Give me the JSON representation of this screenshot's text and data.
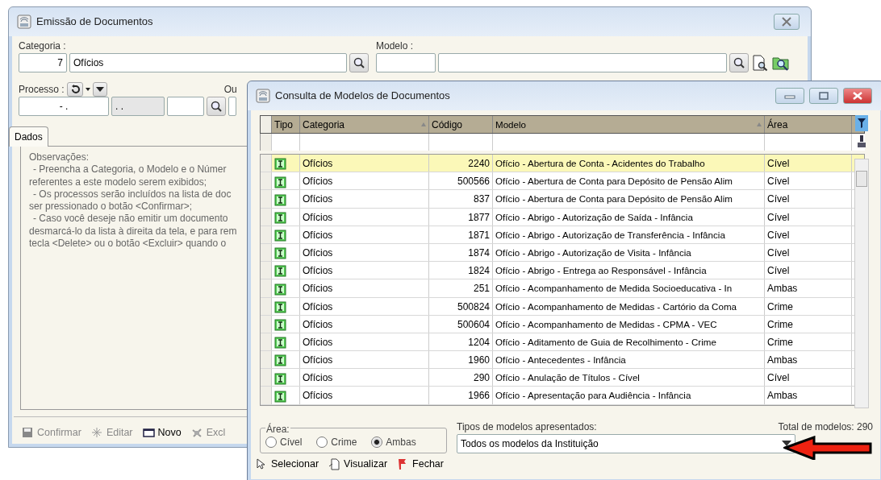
{
  "main_window": {
    "title": "Emissão de Documentos",
    "categoria": {
      "label": "Categoria :",
      "code": "7",
      "name": "Ofícios"
    },
    "modelo": {
      "label": "Modelo :"
    },
    "processo": {
      "label": "Processo :",
      "field_1": "- .",
      "field_2": ". ."
    },
    "cut_label": "Ou",
    "tabs": [
      {
        "label": "Dados",
        "selected": true
      }
    ],
    "notes": [
      "Observações:",
      "- Preencha a Categoria, o Modelo e o Númer",
      "referentes a este modelo serem exibidos;",
      "- Os processos serão incluídos na lista de doc",
      "ser pressionado o botão <Confirmar>;",
      "- Caso você deseje não emitir um documento",
      "desmarcá-lo da lista à direita da tela, e para rem",
      "tecla <Delete> ou o botão <Excluir> quando o"
    ],
    "toolbar": [
      {
        "label": "Confirmar",
        "kind": "save",
        "disabled": true
      },
      {
        "label": "Editar",
        "kind": "edit",
        "disabled": true
      },
      {
        "label": "Novo",
        "kind": "new",
        "disabled": false
      },
      {
        "label": "Excl",
        "kind": "delete",
        "disabled": true
      }
    ]
  },
  "dialog": {
    "title": "Consulta de Modelos de Documentos",
    "table": {
      "columns": [
        {
          "label": "Tipo",
          "sorted": false
        },
        {
          "label": "Categoria",
          "sorted": true
        },
        {
          "label": "Código",
          "sorted": false
        },
        {
          "label": "Modelo",
          "sorted": true
        },
        {
          "label": "Área",
          "sorted": false
        }
      ],
      "rows": [
        {
          "categoria": "Ofícios",
          "codigo": "2240",
          "modelo": "Ofício - Abertura de Conta - Acidentes do Trabalho",
          "area": "Cível",
          "selected": true
        },
        {
          "categoria": "Ofícios",
          "codigo": "500566",
          "modelo": "Ofício - Abertura de Conta para Depósito de Pensão Alim",
          "area": "Cível",
          "selected": false
        },
        {
          "categoria": "Ofícios",
          "codigo": "837",
          "modelo": "Ofício - Abertura de Conta para Depósito de Pensão Alim",
          "area": "Cível",
          "selected": false
        },
        {
          "categoria": "Ofícios",
          "codigo": "1877",
          "modelo": "Ofício - Abrigo - Autorização de Saída - Infância",
          "area": "Cível",
          "selected": false
        },
        {
          "categoria": "Ofícios",
          "codigo": "1871",
          "modelo": "Ofício - Abrigo - Autorização de Transferência - Infância",
          "area": "Cível",
          "selected": false
        },
        {
          "categoria": "Ofícios",
          "codigo": "1874",
          "modelo": "Ofício - Abrigo - Autorização de Visita - Infância",
          "area": "Cível",
          "selected": false
        },
        {
          "categoria": "Ofícios",
          "codigo": "1824",
          "modelo": "Ofício - Abrigo - Entrega ao Responsável - Infância",
          "area": "Cível",
          "selected": false
        },
        {
          "categoria": "Ofícios",
          "codigo": "251",
          "modelo": "Ofício - Acompanhamento de Medida Socioeducativa - In",
          "area": "Ambas",
          "selected": false
        },
        {
          "categoria": "Ofícios",
          "codigo": "500824",
          "modelo": "Ofício - Acompanhamento de Medidas - Cartório da Coma",
          "area": "Crime",
          "selected": false
        },
        {
          "categoria": "Ofícios",
          "codigo": "500604",
          "modelo": "Ofício - Acompanhamento de Medidas - CPMA - VEC",
          "area": "Crime",
          "selected": false
        },
        {
          "categoria": "Ofícios",
          "codigo": "1204",
          "modelo": "Ofício - Aditamento de Guia de Recolhimento - Crime",
          "area": "Crime",
          "selected": false
        },
        {
          "categoria": "Ofícios",
          "codigo": "1960",
          "modelo": "Ofício - Antecedentes - Infância",
          "area": "Ambas",
          "selected": false
        },
        {
          "categoria": "Ofícios",
          "codigo": "290",
          "modelo": "Ofício - Anulação de Títulos - Cível",
          "area": "Cível",
          "selected": false
        },
        {
          "categoria": "Ofícios",
          "codigo": "1966",
          "modelo": "Ofício - Apresentação para Audiência - Infância",
          "area": "Ambas",
          "selected": false
        }
      ]
    },
    "area_filter": {
      "label": "Área:",
      "options": [
        {
          "label": "Cível",
          "selected": false
        },
        {
          "label": "Crime",
          "selected": false
        },
        {
          "label": "Ambas",
          "selected": true
        }
      ]
    },
    "tipos": {
      "label": "Tipos de modelos apresentados:",
      "value": "Todos os modelos da Instituição"
    },
    "total": "Total de modelos: 290",
    "toolbar": [
      {
        "label": "Selecionar",
        "kind": "select"
      },
      {
        "label": "Visualizar",
        "kind": "view"
      },
      {
        "label": "Fechar",
        "kind": "close"
      }
    ]
  }
}
